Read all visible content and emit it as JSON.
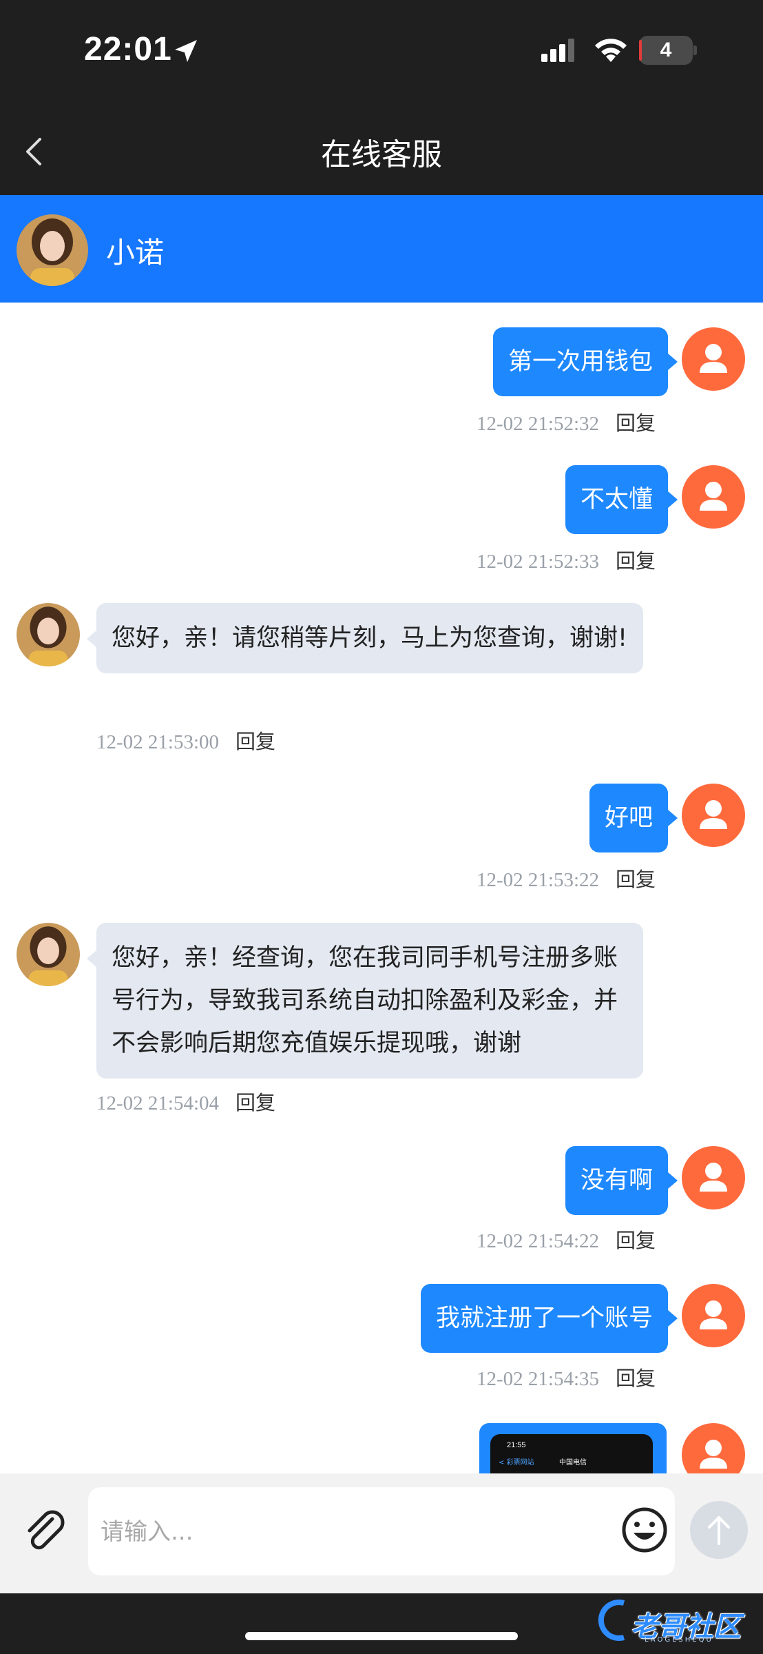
{
  "status_bar": {
    "time": "22:01",
    "battery": "4"
  },
  "nav": {
    "title": "在线客服"
  },
  "agent": {
    "name": "小诺"
  },
  "messages": [
    {
      "side": "right",
      "text": "第一次用钱包",
      "timestamp": "12-02 21:52:32",
      "reply": "回复"
    },
    {
      "side": "right",
      "text": "不太懂",
      "timestamp": "12-02 21:52:33",
      "reply": "回复"
    },
    {
      "side": "left",
      "text": "您好，亲！请您稍等片刻，马上为您查询，谢谢!",
      "timestamp": "12-02 21:53:00",
      "reply": "回复"
    },
    {
      "side": "right",
      "text": "好吧",
      "timestamp": "12-02 21:53:22",
      "reply": "回复"
    },
    {
      "side": "left",
      "text": "您好，亲！经查询，您在我司同手机号注册多账号行为，导致我司系统自动扣除盈利及彩金，并不会影响后期您充值娱乐提现哦，谢谢",
      "timestamp": "12-02 21:54:04",
      "reply": "回复"
    },
    {
      "side": "right",
      "text": "没有啊",
      "timestamp": "12-02 21:54:22",
      "reply": "回复"
    },
    {
      "side": "right",
      "text": "我就注册了一个账号",
      "timestamp": "12-02 21:54:35",
      "reply": "回复"
    }
  ],
  "image_message": {
    "thumb_time": "21:55",
    "thumb_back": "< 彩票网站",
    "thumb_carrier": "中国电信"
  },
  "input": {
    "placeholder": "请输入..."
  },
  "watermark": {
    "text": "老哥社区",
    "sub": "LAOGESHEQU"
  },
  "colors": {
    "header": "#1f1f1f",
    "agent_bar": "#1677ff",
    "user_bubble": "#1e88ff",
    "agent_bubble": "#e3e8f1",
    "user_avatar": "#ff6a3d"
  }
}
